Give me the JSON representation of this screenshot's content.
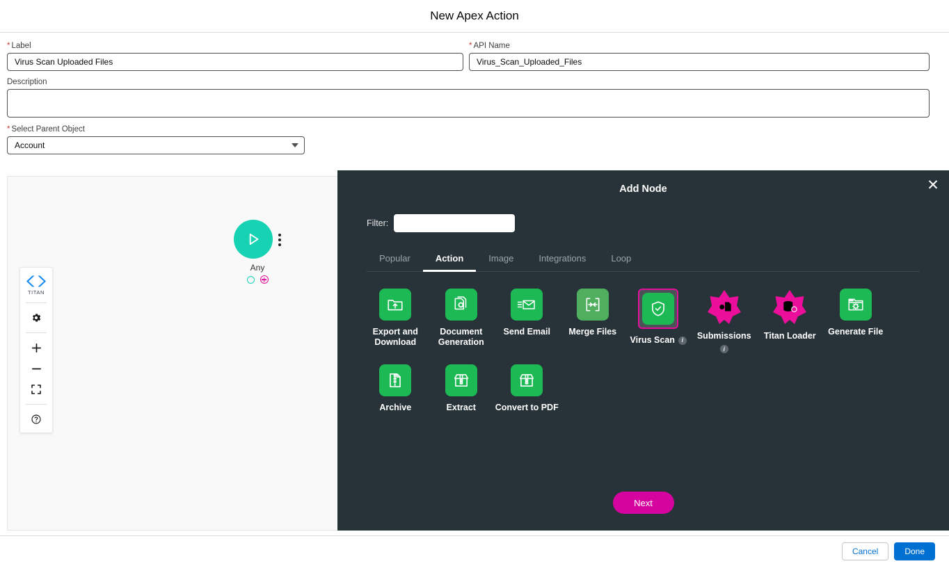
{
  "header": {
    "title": "New Apex Action"
  },
  "form": {
    "label_field": {
      "label": "Label",
      "required": true,
      "value": "Virus Scan Uploaded Files"
    },
    "api_name_field": {
      "label": "API Name",
      "required": true,
      "value": "Virus_Scan_Uploaded_Files"
    },
    "description_field": {
      "label": "Description",
      "required": false,
      "value": ""
    },
    "parent_object_field": {
      "label": "Select Parent Object",
      "required": true,
      "value": "Account"
    }
  },
  "canvas": {
    "toolbar": {
      "logo_text": "TITAN",
      "items": [
        {
          "name": "settings",
          "icon": "gear-icon"
        },
        {
          "name": "zoom-in",
          "icon": "plus-icon"
        },
        {
          "name": "zoom-out",
          "icon": "minus-icon"
        },
        {
          "name": "fit-screen",
          "icon": "fit-screen-icon"
        },
        {
          "name": "help",
          "icon": "help-icon"
        }
      ]
    },
    "start_node": {
      "label": "Any",
      "icon": "play-icon"
    }
  },
  "modal": {
    "title": "Add Node",
    "close_label": "✕",
    "filter": {
      "label": "Filter:",
      "value": "",
      "placeholder": ""
    },
    "tabs": [
      {
        "label": "Popular",
        "active": false
      },
      {
        "label": "Action",
        "active": true
      },
      {
        "label": "Image",
        "active": false
      },
      {
        "label": "Integrations",
        "active": false
      },
      {
        "label": "Loop",
        "active": false
      }
    ],
    "nodes": [
      {
        "label": "Export and Download",
        "icon": "folder-upload-icon",
        "style": "green",
        "info": false,
        "selected": false
      },
      {
        "label": "Document Generation",
        "icon": "documents-gear-icon",
        "style": "green",
        "info": false,
        "selected": false
      },
      {
        "label": "Send Email",
        "icon": "envelope-icon",
        "style": "green",
        "info": false,
        "selected": false
      },
      {
        "label": "Merge Files",
        "icon": "merge-arrows-icon",
        "style": "green-muted",
        "info": false,
        "selected": false
      },
      {
        "label": "Virus Scan",
        "icon": "shield-check-icon",
        "style": "green",
        "info": true,
        "selected": true
      },
      {
        "label": "Submissions",
        "icon": "star-document-icon",
        "style": "pink-star",
        "info": true,
        "selected": false
      },
      {
        "label": "Titan Loader",
        "icon": "star-database-icon",
        "style": "pink-star",
        "info": false,
        "selected": false
      },
      {
        "label": "Generate File",
        "icon": "folder-gear-icon",
        "style": "green",
        "info": false,
        "selected": false
      },
      {
        "label": "Archive",
        "icon": "zip-file-icon",
        "style": "green",
        "info": false,
        "selected": false
      },
      {
        "label": "Extract",
        "icon": "unzip-box-icon",
        "style": "green",
        "info": false,
        "selected": false
      },
      {
        "label": "Convert to PDF",
        "icon": "unzip-box-icon",
        "style": "green",
        "info": false,
        "selected": false
      }
    ],
    "next_label": "Next"
  },
  "footer": {
    "cancel_label": "Cancel",
    "done_label": "Done"
  },
  "colors": {
    "modal_bg": "#283339",
    "accent_magenta": "#d6049f",
    "icon_green": "#1db954",
    "icon_green_muted": "#4faf5f",
    "node_teal": "#17d3b4",
    "primary_blue": "#0070d2",
    "required_red": "#c23934"
  }
}
